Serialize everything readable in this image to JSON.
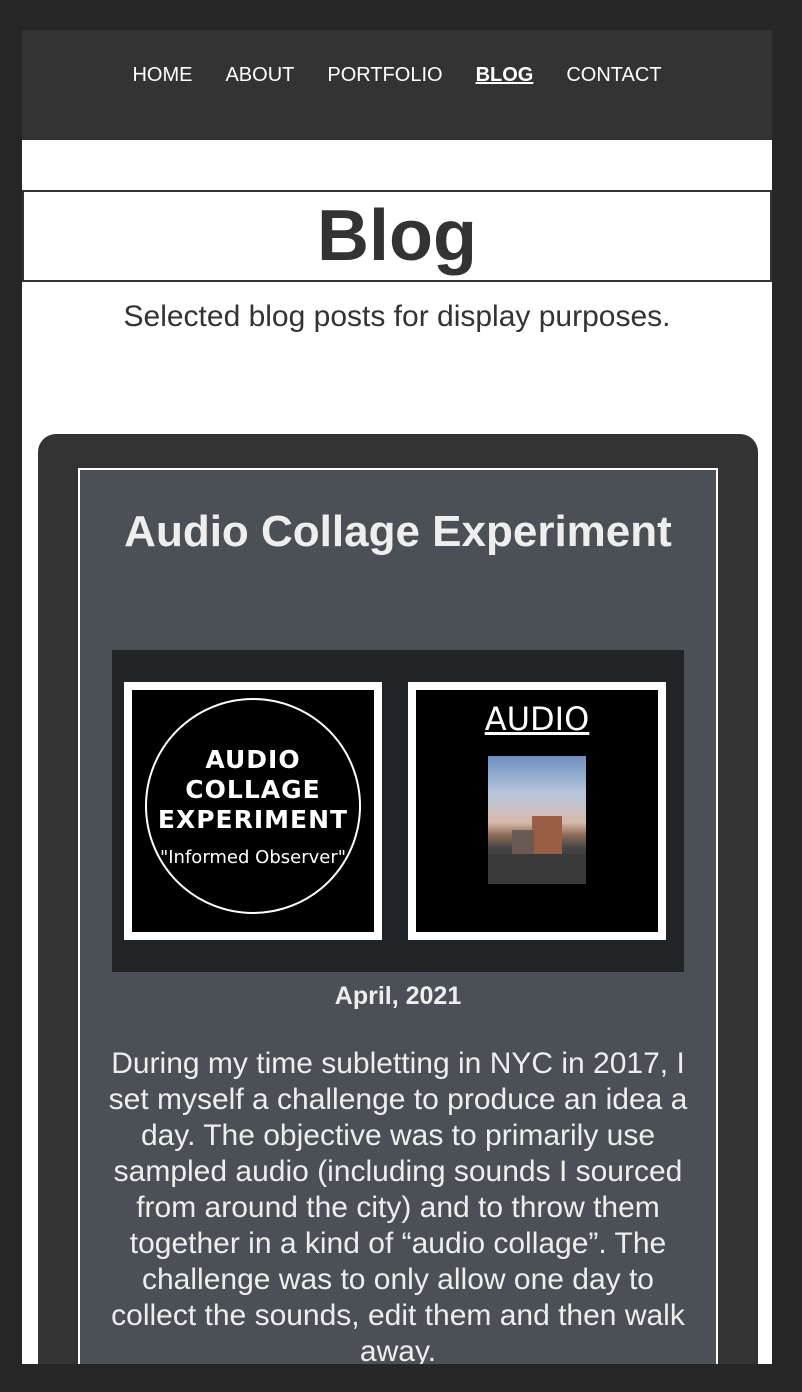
{
  "nav": {
    "items": [
      {
        "label": "HOME",
        "active": false
      },
      {
        "label": "ABOUT",
        "active": false
      },
      {
        "label": "PORTFOLIO",
        "active": false
      },
      {
        "label": "BLOG",
        "active": true
      },
      {
        "label": "CONTACT",
        "active": false
      }
    ]
  },
  "page": {
    "title": "Blog",
    "subtitle": "Selected blog posts for display purposes."
  },
  "post": {
    "title": "Audio Collage Experiment",
    "thumb1": {
      "lines": [
        "AUDIO",
        "COLLAGE",
        "EXPERIMENT"
      ],
      "caption": "\"Informed Observer\""
    },
    "thumb2": {
      "word": "AUDIO"
    },
    "date": "April, 2021",
    "body": "During my time subletting in NYC in 2017, I set myself a challenge to produce an idea a day. The objective was to primarily use sampled audio (including sounds I sourced from around the city) and to throw them together in a kind of “audio collage”. The challenge was to only allow one day to collect the sounds, edit them and then walk away."
  },
  "colors": {
    "background": "#262626",
    "nav": "#333333",
    "card": "#4b4f56",
    "gallery": "#212427"
  }
}
